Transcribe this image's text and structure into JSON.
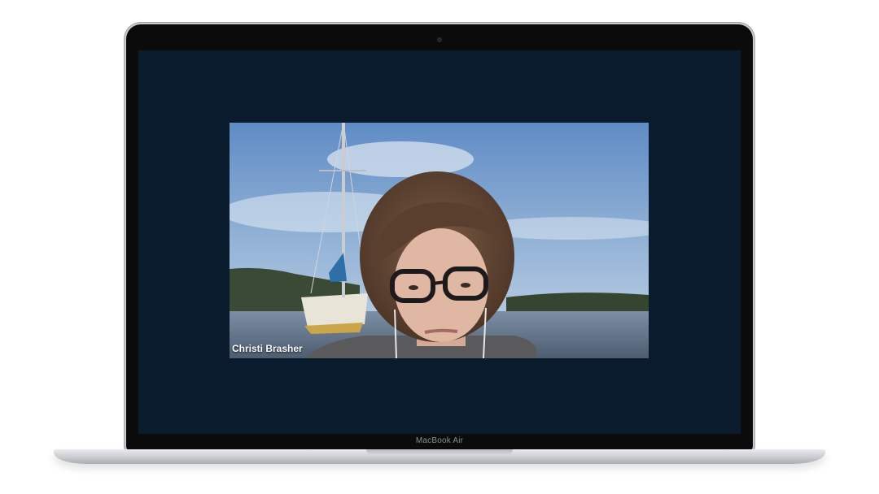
{
  "device": {
    "label": "MacBook Air"
  },
  "meeting": {
    "participants": [
      {
        "name": "Christi Brasher"
      }
    ]
  }
}
